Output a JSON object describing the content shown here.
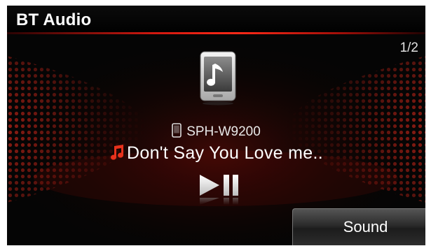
{
  "header": {
    "title": "BT Audio",
    "page_indicator": "1/2"
  },
  "player": {
    "source_icon": "phone-music-icon",
    "device_icon": "mobile-phone-icon",
    "device_name": "SPH-W9200",
    "track_icon": "music-note-icon",
    "track_title": "Don't Say You Love me..",
    "control_icon": "play-pause-icon"
  },
  "buttons": {
    "sound_label": "Sound"
  },
  "colors": {
    "accent": "#d0180f",
    "note": "#e8321c",
    "background": "#050505",
    "text": "#ffffff"
  }
}
